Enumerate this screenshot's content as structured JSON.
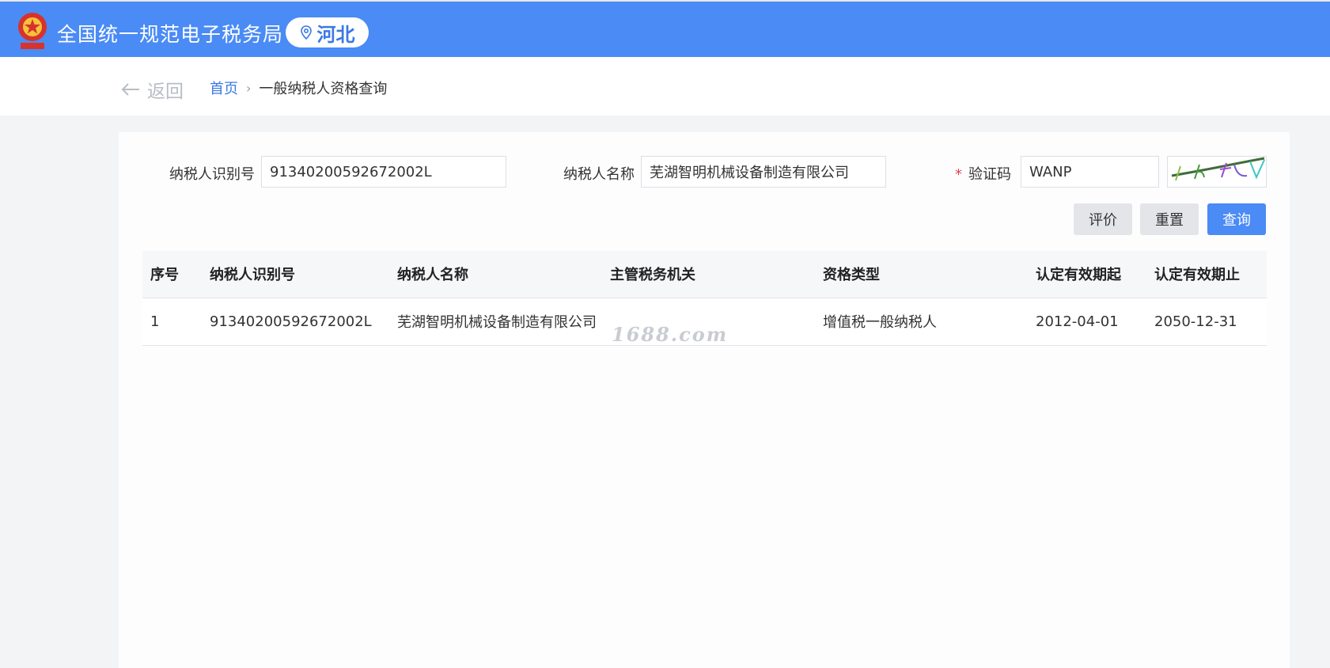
{
  "header": {
    "site_title": "全国统一规范电子税务局",
    "region": "河北",
    "logo_icon": "tax-emblem-icon",
    "colors": {
      "bar": "#4a8bf5",
      "accent": "#3a78e6"
    }
  },
  "nav": {
    "back_label": "返回",
    "breadcrumb": {
      "home": "首页",
      "separator": "›",
      "current": "一般纳税人资格查询"
    }
  },
  "form": {
    "taxpayer_id": {
      "label": "纳税人识别号",
      "value": "91340200592672002L"
    },
    "taxpayer_name": {
      "label": "纳税人名称",
      "value": "芜湖智明机械设备制造有限公司"
    },
    "captcha": {
      "required_mark": "*",
      "label": "验证码",
      "value": "WANP"
    },
    "buttons": {
      "evaluate": "评价",
      "reset": "重置",
      "query": "查询"
    }
  },
  "table": {
    "columns": [
      "序号",
      "纳税人识别号",
      "纳税人名称",
      "主管税务机关",
      "资格类型",
      "认定有效期起",
      "认定有效期止"
    ],
    "rows": [
      [
        "1",
        "91340200592672002L",
        "芜湖智明机械设备制造有限公司",
        "",
        "增值税一般纳税人",
        "2012-04-01",
        "2050-12-31"
      ]
    ]
  },
  "watermark": "1688.com"
}
